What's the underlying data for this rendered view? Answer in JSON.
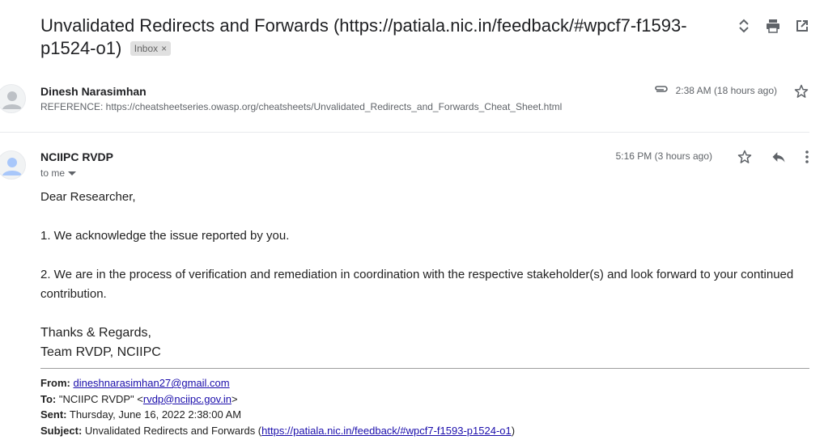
{
  "thread": {
    "subject": "Unvalidated Redirects and Forwards (https://patiala.nic.in/feedback/#wpcf7-f1593-p1524-o1)",
    "label": "Inbox",
    "label_remove": "×"
  },
  "toolbar": {
    "icons": [
      "expand-collapse-icon",
      "print-icon",
      "open-in-new-window-icon"
    ]
  },
  "message1": {
    "sender": "Dinesh Narasimhan",
    "snippet": "REFERENCE: https://cheatsheetseries.owasp.org/cheatsheets/Unvalidated_Redirects_and_Forwards_Cheat_Sheet.html",
    "time": "2:38 AM (18 hours ago)",
    "has_attachment": true,
    "starred": false
  },
  "message2": {
    "sender": "NCIIPC RVDP",
    "to": "to me",
    "time": "5:16 PM (3 hours ago)",
    "starred": false,
    "body": {
      "greeting": "Dear Researcher,",
      "point1": "1. We acknowledge the issue reported by you.",
      "point2": "2. We are in the process of verification and remediation in coordination with the respective stakeholder(s) and look forward to your continued contribution.",
      "regards": "Thanks & Regards,",
      "team": "Team RVDP, NCIIPC"
    },
    "forwarded": {
      "from_label": "From:",
      "from_value": "dineshnarasimhan27@gmail.com",
      "to_label": "To:",
      "to_prefix": "\"NCIIPC RVDP\" <",
      "to_email": "rvdp@nciipc.gov.in",
      "to_suffix": ">",
      "sent_label": "Sent:",
      "sent_value": "Thursday, June 16, 2022 2:38:00 AM",
      "subject_label": "Subject:",
      "subject_prefix": "Unvalidated Redirects and Forwards (",
      "subject_link": "https://patiala.nic.in/feedback/#wpcf7-f1593-p1524-o1",
      "subject_suffix": ")"
    }
  },
  "colors": {
    "text": "#202124",
    "secondary": "#5f6368",
    "link": "#1a0dab",
    "badge_bg": "#e0e0e0"
  }
}
